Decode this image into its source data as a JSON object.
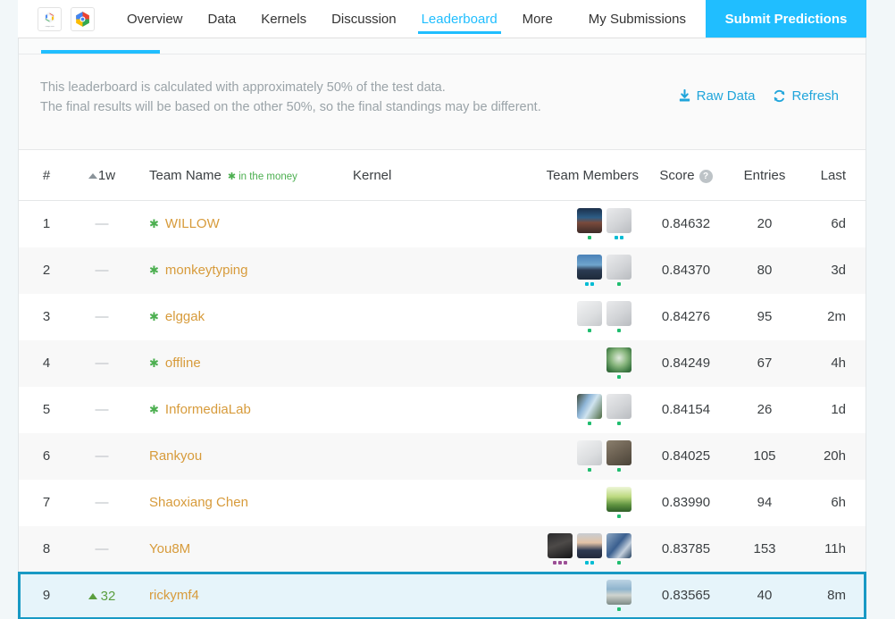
{
  "topnav": {
    "logos": [
      {
        "name": "google-cloud-logo-muted",
        "caption": "Google Cloud"
      },
      {
        "name": "google-cloud-logo"
      }
    ],
    "tabs": [
      {
        "label": "Overview",
        "active": false
      },
      {
        "label": "Data",
        "active": false
      },
      {
        "label": "Kernels",
        "active": false
      },
      {
        "label": "Discussion",
        "active": false
      },
      {
        "label": "Leaderboard",
        "active": true
      },
      {
        "label": "More",
        "active": false
      }
    ],
    "my_submissions_label": "My Submissions",
    "submit_button_label": "Submit Predictions",
    "accent_color": "#20beff"
  },
  "banner": {
    "line1": "This leaderboard is calculated with approximately 50% of the test data.",
    "line2": "The final results will be based on the other 50%, so the final standings may be different.",
    "raw_data_label": "Raw Data",
    "refresh_label": "Refresh",
    "link_color": "#20a5db"
  },
  "table": {
    "headers": {
      "rank": "#",
      "delta": "1w",
      "team_name": "Team Name",
      "in_the_money": "in the money",
      "kernel": "Kernel",
      "team_members": "Team Members",
      "score": "Score",
      "entries": "Entries",
      "last": "Last"
    },
    "rows": [
      {
        "rank": "1",
        "delta": "—",
        "delta_dir": "none",
        "team": "WILLOW",
        "in_money": true,
        "kernel": "",
        "score": "0.84632",
        "entries": "20",
        "last": "6d",
        "members": [
          {
            "avatar": "photo-person-waterfront",
            "tier": "contributor",
            "tier_dots": 1
          },
          {
            "avatar": "goose-sketch",
            "tier": "expert",
            "tier_dots": 2
          }
        ]
      },
      {
        "rank": "2",
        "delta": "—",
        "delta_dir": "none",
        "team": "monkeytyping",
        "in_money": true,
        "kernel": "",
        "score": "0.84370",
        "entries": "80",
        "last": "3d",
        "members": [
          {
            "avatar": "photo-person-lake",
            "tier": "expert",
            "tier_dots": 2
          },
          {
            "avatar": "goose-sketch",
            "tier": "contributor",
            "tier_dots": 1
          }
        ]
      },
      {
        "rank": "3",
        "delta": "—",
        "delta_dir": "none",
        "team": "elggak",
        "in_money": true,
        "kernel": "",
        "score": "0.84276",
        "entries": "95",
        "last": "2m",
        "members": [
          {
            "avatar": "goose-sketch-light",
            "tier": "contributor",
            "tier_dots": 1
          },
          {
            "avatar": "goose-sketch",
            "tier": "contributor",
            "tier_dots": 1
          }
        ]
      },
      {
        "rank": "4",
        "delta": "—",
        "delta_dir": "none",
        "team": "offline",
        "in_money": true,
        "kernel": "",
        "score": "0.84249",
        "entries": "67",
        "last": "4h",
        "members": [
          {
            "avatar": "anime-green-portrait",
            "tier": "contributor",
            "tier_dots": 1
          }
        ]
      },
      {
        "rank": "5",
        "delta": "—",
        "delta_dir": "none",
        "team": "InformediaLab",
        "in_money": true,
        "kernel": "",
        "score": "0.84154",
        "entries": "26",
        "last": "1d",
        "members": [
          {
            "avatar": "photo-hand-phone",
            "tier": "contributor",
            "tier_dots": 1
          },
          {
            "avatar": "goose-sketch",
            "tier": "contributor",
            "tier_dots": 1
          }
        ]
      },
      {
        "rank": "6",
        "delta": "—",
        "delta_dir": "none",
        "team": "Rankyou",
        "in_money": false,
        "kernel": "",
        "score": "0.84025",
        "entries": "105",
        "last": "20h",
        "members": [
          {
            "avatar": "goose-sketch-light",
            "tier": "contributor",
            "tier_dots": 1
          },
          {
            "avatar": "koala-photo",
            "tier": "contributor",
            "tier_dots": 1
          }
        ]
      },
      {
        "rank": "7",
        "delta": "—",
        "delta_dir": "none",
        "team": "Shaoxiang Chen",
        "in_money": false,
        "kernel": "",
        "score": "0.83990",
        "entries": "94",
        "last": "6h",
        "members": [
          {
            "avatar": "green-field-photo",
            "tier": "contributor",
            "tier_dots": 1
          }
        ]
      },
      {
        "rank": "8",
        "delta": "—",
        "delta_dir": "none",
        "team": "You8M",
        "in_money": false,
        "kernel": "",
        "score": "0.83785",
        "entries": "153",
        "last": "11h",
        "members": [
          {
            "avatar": "dark-portrait",
            "tier": "master",
            "tier_dots": 3
          },
          {
            "avatar": "man-suit-portrait",
            "tier": "expert",
            "tier_dots": 2
          },
          {
            "avatar": "blue-building-photo",
            "tier": "contributor",
            "tier_dots": 1
          }
        ]
      },
      {
        "rank": "9",
        "delta": "32",
        "delta_dir": "up",
        "team": "rickymf4",
        "in_money": false,
        "kernel": "",
        "score": "0.83565",
        "entries": "40",
        "last": "8m",
        "highlight": true,
        "members": [
          {
            "avatar": "street-scene-photo",
            "tier": "contributor",
            "tier_dots": 1
          }
        ]
      }
    ]
  }
}
